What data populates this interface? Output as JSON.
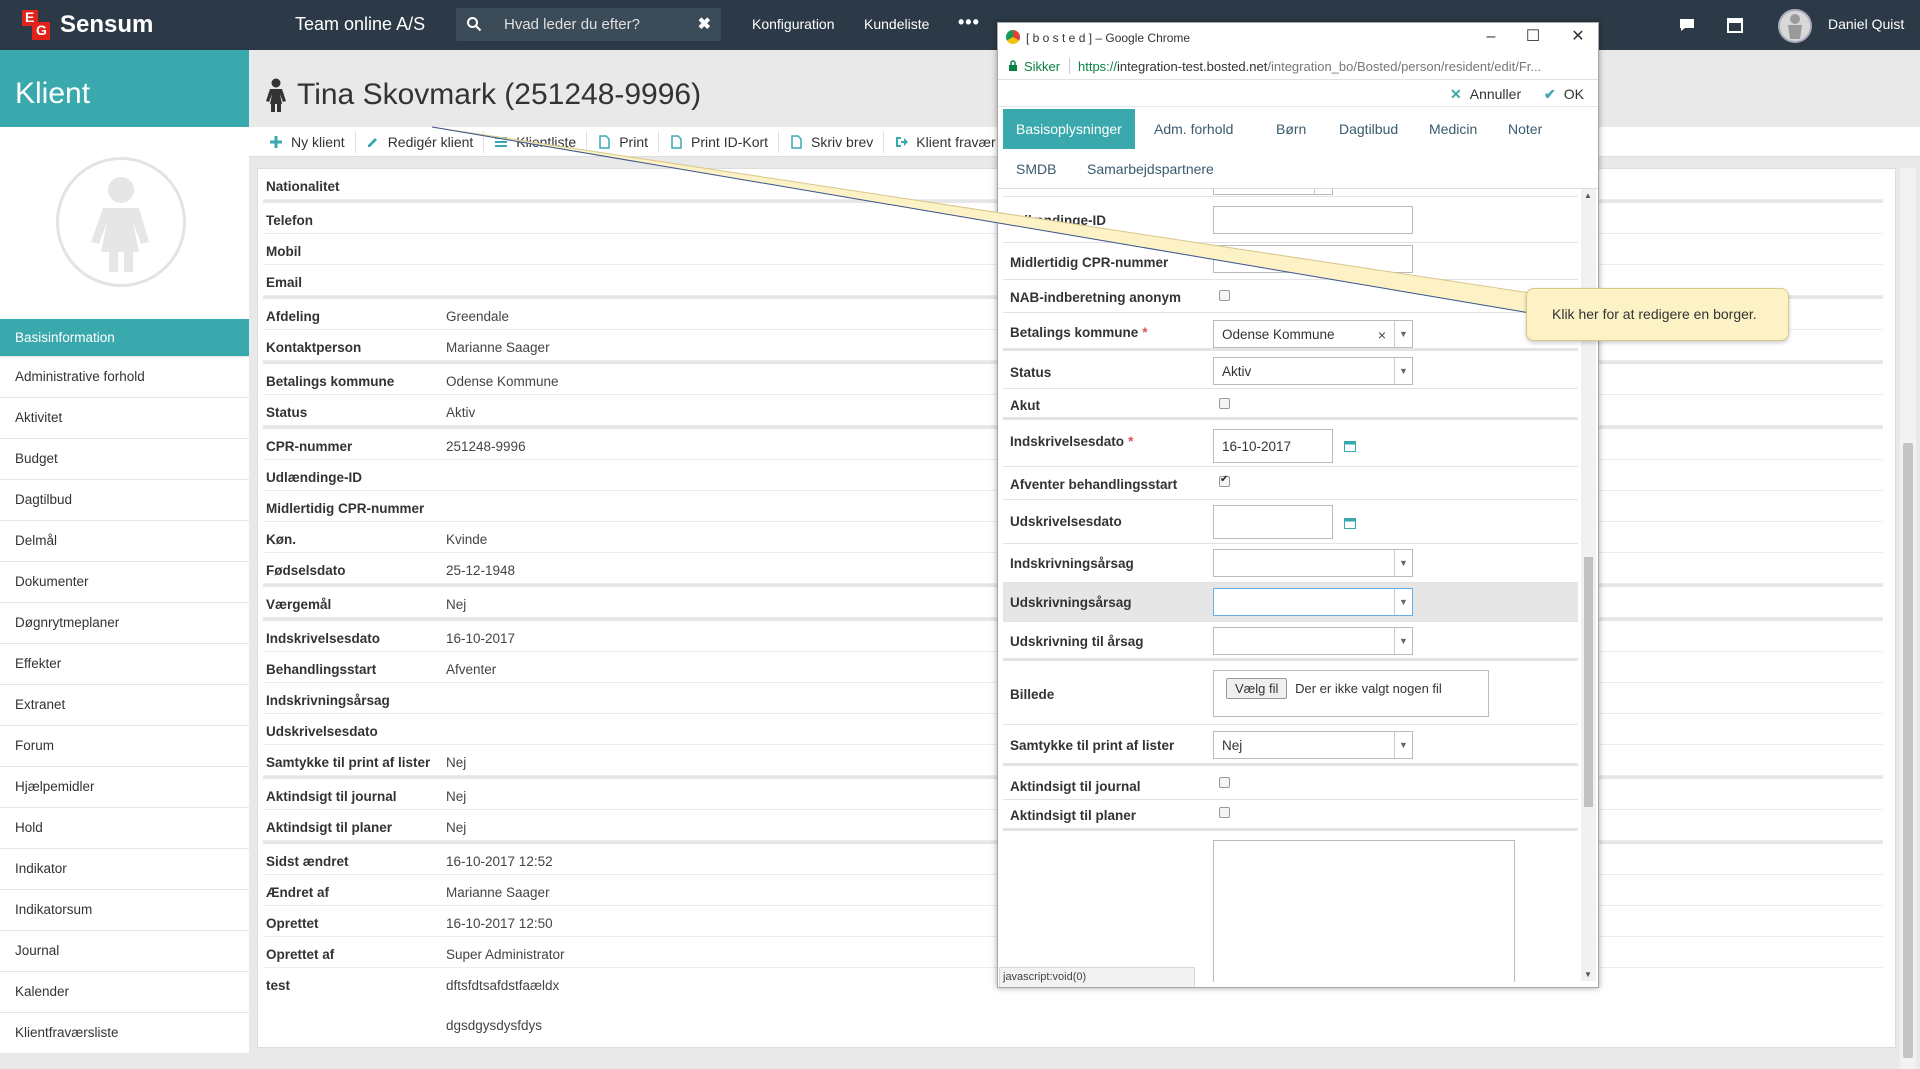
{
  "topbar": {
    "brand": "Sensum",
    "logo_letters": [
      "E",
      "G"
    ],
    "team": "Team online A/S",
    "search_placeholder": "Hvad leder du efter?",
    "search_clear": "✖",
    "links": [
      "Konfiguration",
      "Kundeliste"
    ],
    "more": "•••",
    "user": "Daniel Quist",
    "accent": "#2b3a46"
  },
  "sidebar": {
    "title": "Klient",
    "items": [
      "Basisinformation",
      "Administrative forhold",
      "Aktivitet",
      "Budget",
      "Dagtilbud",
      "Delmål",
      "Dokumenter",
      "Døgnrytmeplaner",
      "Effekter",
      "Extranet",
      "Forum",
      "Hjælpemidler",
      "Hold",
      "Indikator",
      "Indikatorsum",
      "Journal",
      "Kalender",
      "Klientfraværsliste"
    ],
    "active_index": 0,
    "accent": "#3aa9ad"
  },
  "page": {
    "title": "Tina Skovmark (251248-9996)",
    "toolbar": [
      "Ny klient",
      "Redigér klient",
      "Klientliste",
      "Print",
      "Print ID-Kort",
      "Skriv brev",
      "Klient fravær"
    ]
  },
  "details": [
    {
      "label": "Nationalitet",
      "value": ""
    },
    {
      "label": "Telefon",
      "value": ""
    },
    {
      "label": "Mobil",
      "value": ""
    },
    {
      "label": "Email",
      "value": ""
    },
    {
      "label": "Afdeling",
      "value": "Greendale"
    },
    {
      "label": "Kontaktperson",
      "value": "Marianne Saager"
    },
    {
      "label": "Betalings kommune",
      "value": "Odense Kommune"
    },
    {
      "label": "Status",
      "value": "Aktiv"
    },
    {
      "label": "CPR-nummer",
      "value": "251248-9996"
    },
    {
      "label": "Udlændinge-ID",
      "value": ""
    },
    {
      "label": "Midlertidig CPR-nummer",
      "value": ""
    },
    {
      "label": "Køn.",
      "value": "Kvinde"
    },
    {
      "label": "Fødselsdato",
      "value": "25-12-1948"
    },
    {
      "label": "Værgemål",
      "value": "Nej"
    },
    {
      "label": "Indskrivelsesdato",
      "value": "16-10-2017"
    },
    {
      "label": "Behandlingsstart",
      "value": "Afventer"
    },
    {
      "label": "Indskrivningsårsag",
      "value": ""
    },
    {
      "label": "Udskrivelsesdato",
      "value": ""
    },
    {
      "label": "Samtykke til print af lister",
      "value": "Nej"
    },
    {
      "label": "Aktindsigt til journal",
      "value": "Nej"
    },
    {
      "label": "Aktindsigt til planer",
      "value": "Nej"
    },
    {
      "label": "Sidst ændret",
      "value": "16-10-2017 12:52"
    },
    {
      "label": "Ændret af",
      "value": "Marianne Saager"
    },
    {
      "label": "Oprettet",
      "value": "16-10-2017 12:50"
    },
    {
      "label": "Oprettet af",
      "value": "Super Administrator"
    },
    {
      "label": "test",
      "value": "dftsfdtsafdstfaældx"
    },
    {
      "label": "",
      "value": "dgsdgysdysfdys"
    }
  ],
  "popup": {
    "window_title": "[ b o s t e d ] – Google Chrome",
    "secure_label": "Sikker",
    "url_scheme": "https://",
    "url_host": "integration-test.bosted.net",
    "url_path": "/integration_bo/Bosted/person/resident/edit/Fr...",
    "cancel": "Annuller",
    "ok": "OK",
    "tabs": [
      "Basisoplysninger",
      "Adm. forhold",
      "Børn",
      "Dagtilbud",
      "Medicin",
      "Noter",
      "SMDB",
      "Samarbejdspartnere"
    ],
    "active_tab": 0,
    "fields": {
      "udl_label": "Udlændinge-ID",
      "midl_cpr": "Midlertidig CPR-nummer",
      "nab": "NAB-indberetning anonym",
      "betalings": "Betalings kommune",
      "betalings_value": "Odense Kommune",
      "status": "Status",
      "status_value": "Aktiv",
      "akut": "Akut",
      "indskr": "Indskrivelsesdato",
      "indskr_value": "16-10-2017",
      "afventer": "Afventer behandlingsstart",
      "udskr": "Udskrivelsesdato",
      "indskr_aarsag": "Indskrivningsårsag",
      "udskr_aarsag": "Udskrivningsårsag",
      "udskr_til": "Udskrivning til årsag",
      "billede": "Billede",
      "file_button": "Vælg fil",
      "file_none": "Der er ikke valgt nogen fil",
      "samtykke": "Samtykke til print af lister",
      "samtykke_value": "Nej",
      "akt_journal": "Aktindsigt til journal",
      "akt_planer": "Aktindsigt til planer",
      "req_mark": "*"
    },
    "status_bar": "javascript:void(0)"
  },
  "tooltip": "Klik her for at redigere en borger."
}
